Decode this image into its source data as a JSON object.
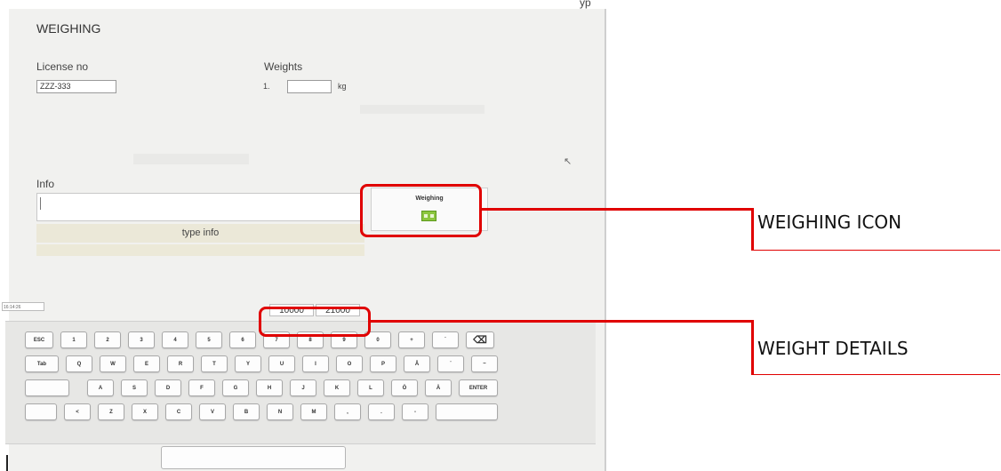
{
  "cut_text": "yp",
  "screen": {
    "title": "WEIGHING",
    "license": {
      "label": "License no",
      "value": "ZZZ-333"
    },
    "weights": {
      "label": "Weights",
      "row_index": "1.",
      "value": "",
      "unit": "kg"
    },
    "info": {
      "label": "Info",
      "value": "",
      "type_info_button": "type info"
    },
    "weighing_button": {
      "label": "Weighing",
      "icon": "scale-icon",
      "icon_color": "#8cc63f"
    },
    "status_left": "16:14:26",
    "weight_details": [
      "10000",
      "21000"
    ]
  },
  "keyboard": {
    "rows": [
      [
        {
          "label": "ESC",
          "name": "key-esc"
        },
        {
          "label": "1",
          "name": "key-1"
        },
        {
          "label": "2",
          "name": "key-2"
        },
        {
          "label": "3",
          "name": "key-3"
        },
        {
          "label": "4",
          "name": "key-4"
        },
        {
          "label": "5",
          "name": "key-5"
        },
        {
          "label": "6",
          "name": "key-6"
        },
        {
          "label": "7",
          "name": "key-7"
        },
        {
          "label": "8",
          "name": "key-8"
        },
        {
          "label": "9",
          "name": "key-9"
        },
        {
          "label": "0",
          "name": "key-0"
        },
        {
          "label": "+",
          "name": "key-plus"
        },
        {
          "label": "´",
          "name": "key-acute"
        },
        {
          "label": "⌫",
          "name": "backspace-icon"
        }
      ],
      [
        {
          "label": "Tab",
          "name": "key-tab"
        },
        {
          "label": "Q",
          "name": "key-q"
        },
        {
          "label": "W",
          "name": "key-w"
        },
        {
          "label": "E",
          "name": "key-e"
        },
        {
          "label": "R",
          "name": "key-r"
        },
        {
          "label": "T",
          "name": "key-t"
        },
        {
          "label": "Y",
          "name": "key-y"
        },
        {
          "label": "U",
          "name": "key-u"
        },
        {
          "label": "I",
          "name": "key-i"
        },
        {
          "label": "O",
          "name": "key-o"
        },
        {
          "label": "P",
          "name": "key-p"
        },
        {
          "label": "Å",
          "name": "key-a-ring"
        },
        {
          "label": "¨",
          "name": "key-diaeresis"
        },
        {
          "label": "~",
          "name": "key-tilde"
        }
      ],
      [
        {
          "label": "",
          "name": "key-caps"
        },
        {
          "label": "A",
          "name": "key-a"
        },
        {
          "label": "S",
          "name": "key-s"
        },
        {
          "label": "D",
          "name": "key-d"
        },
        {
          "label": "F",
          "name": "key-f"
        },
        {
          "label": "G",
          "name": "key-g"
        },
        {
          "label": "H",
          "name": "key-h"
        },
        {
          "label": "J",
          "name": "key-j"
        },
        {
          "label": "K",
          "name": "key-k"
        },
        {
          "label": "L",
          "name": "key-l"
        },
        {
          "label": "Ö",
          "name": "key-o-umlaut"
        },
        {
          "label": "Ä",
          "name": "key-a-umlaut"
        },
        {
          "label": "ENTER",
          "name": "key-enter"
        }
      ],
      [
        {
          "label": "",
          "name": "key-shift-left"
        },
        {
          "label": "<",
          "name": "key-less-than"
        },
        {
          "label": "Z",
          "name": "key-z"
        },
        {
          "label": "X",
          "name": "key-x"
        },
        {
          "label": "C",
          "name": "key-c"
        },
        {
          "label": "V",
          "name": "key-v"
        },
        {
          "label": "B",
          "name": "key-b"
        },
        {
          "label": "N",
          "name": "key-n"
        },
        {
          "label": "M",
          "name": "key-m"
        },
        {
          "label": ",",
          "name": "key-comma"
        },
        {
          "label": ".",
          "name": "key-period"
        },
        {
          "label": "-",
          "name": "key-minus"
        },
        {
          "label": "",
          "name": "key-shift-right"
        }
      ]
    ]
  },
  "callouts": {
    "weighing_icon": "WEIGHING ICON",
    "weight_details": "WEIGHT DETAILS"
  },
  "colors": {
    "highlight": "#e00000",
    "accent_icon": "#8cc63f",
    "panel": "#f1f1ef"
  }
}
